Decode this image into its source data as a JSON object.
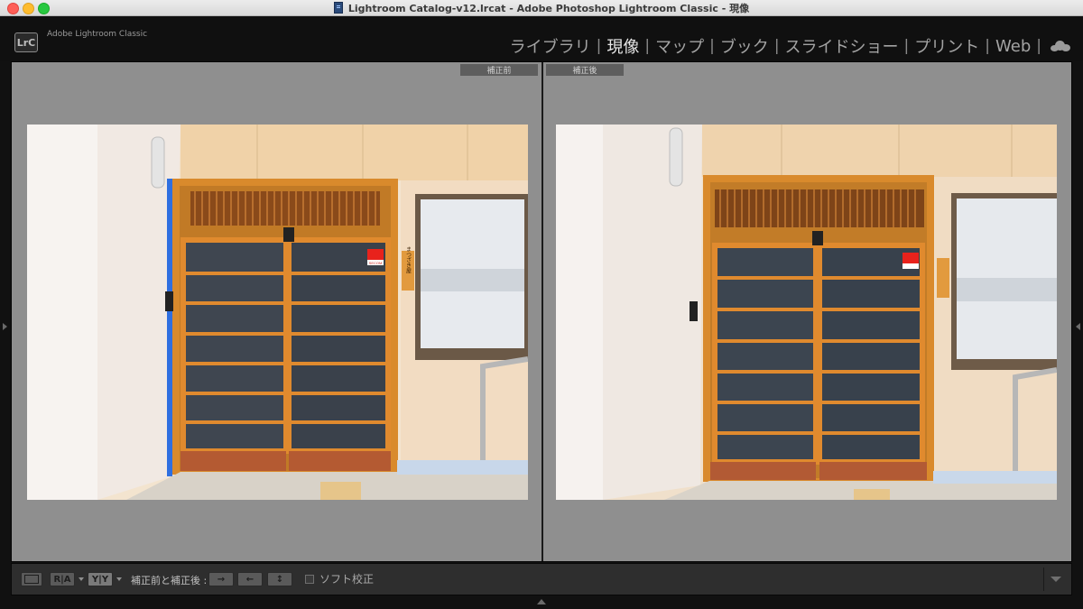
{
  "window": {
    "title": "Lightroom Catalog-v12.lrcat - Adobe Photoshop Lightroom Classic - 現像"
  },
  "header": {
    "badge": "LrC",
    "app_name": "Adobe Lightroom Classic",
    "modules": [
      {
        "label": "ライブラリ",
        "active": false
      },
      {
        "label": "現像",
        "active": true
      },
      {
        "label": "マップ",
        "active": false
      },
      {
        "label": "ブック",
        "active": false
      },
      {
        "label": "スライドショー",
        "active": false
      },
      {
        "label": "プリント",
        "active": false
      },
      {
        "label": "Web",
        "active": false
      }
    ],
    "cloud_icon": "cloud-icon"
  },
  "view": {
    "before_label": "補正前",
    "after_label": "補正後"
  },
  "toolbar": {
    "view_loupe_icon": "loupe-view-icon",
    "view_ra_label": "R|A",
    "view_yy_label": "Y|Y",
    "before_after_label": "補正前と補正後 :",
    "copy_before_to_after": "→",
    "copy_after_to_before": "←",
    "swap": "↕",
    "soft_proof_label": "ソフト校正",
    "soft_proof_checked": false
  },
  "photo": {
    "sign_text": "SECOM",
    "nameplate_text": "まつざき屋"
  },
  "colors": {
    "accent_active_module": "#e6e6e6",
    "panel_bg": "#8f8f8f",
    "clipping_blue": "#2f6fe0"
  }
}
